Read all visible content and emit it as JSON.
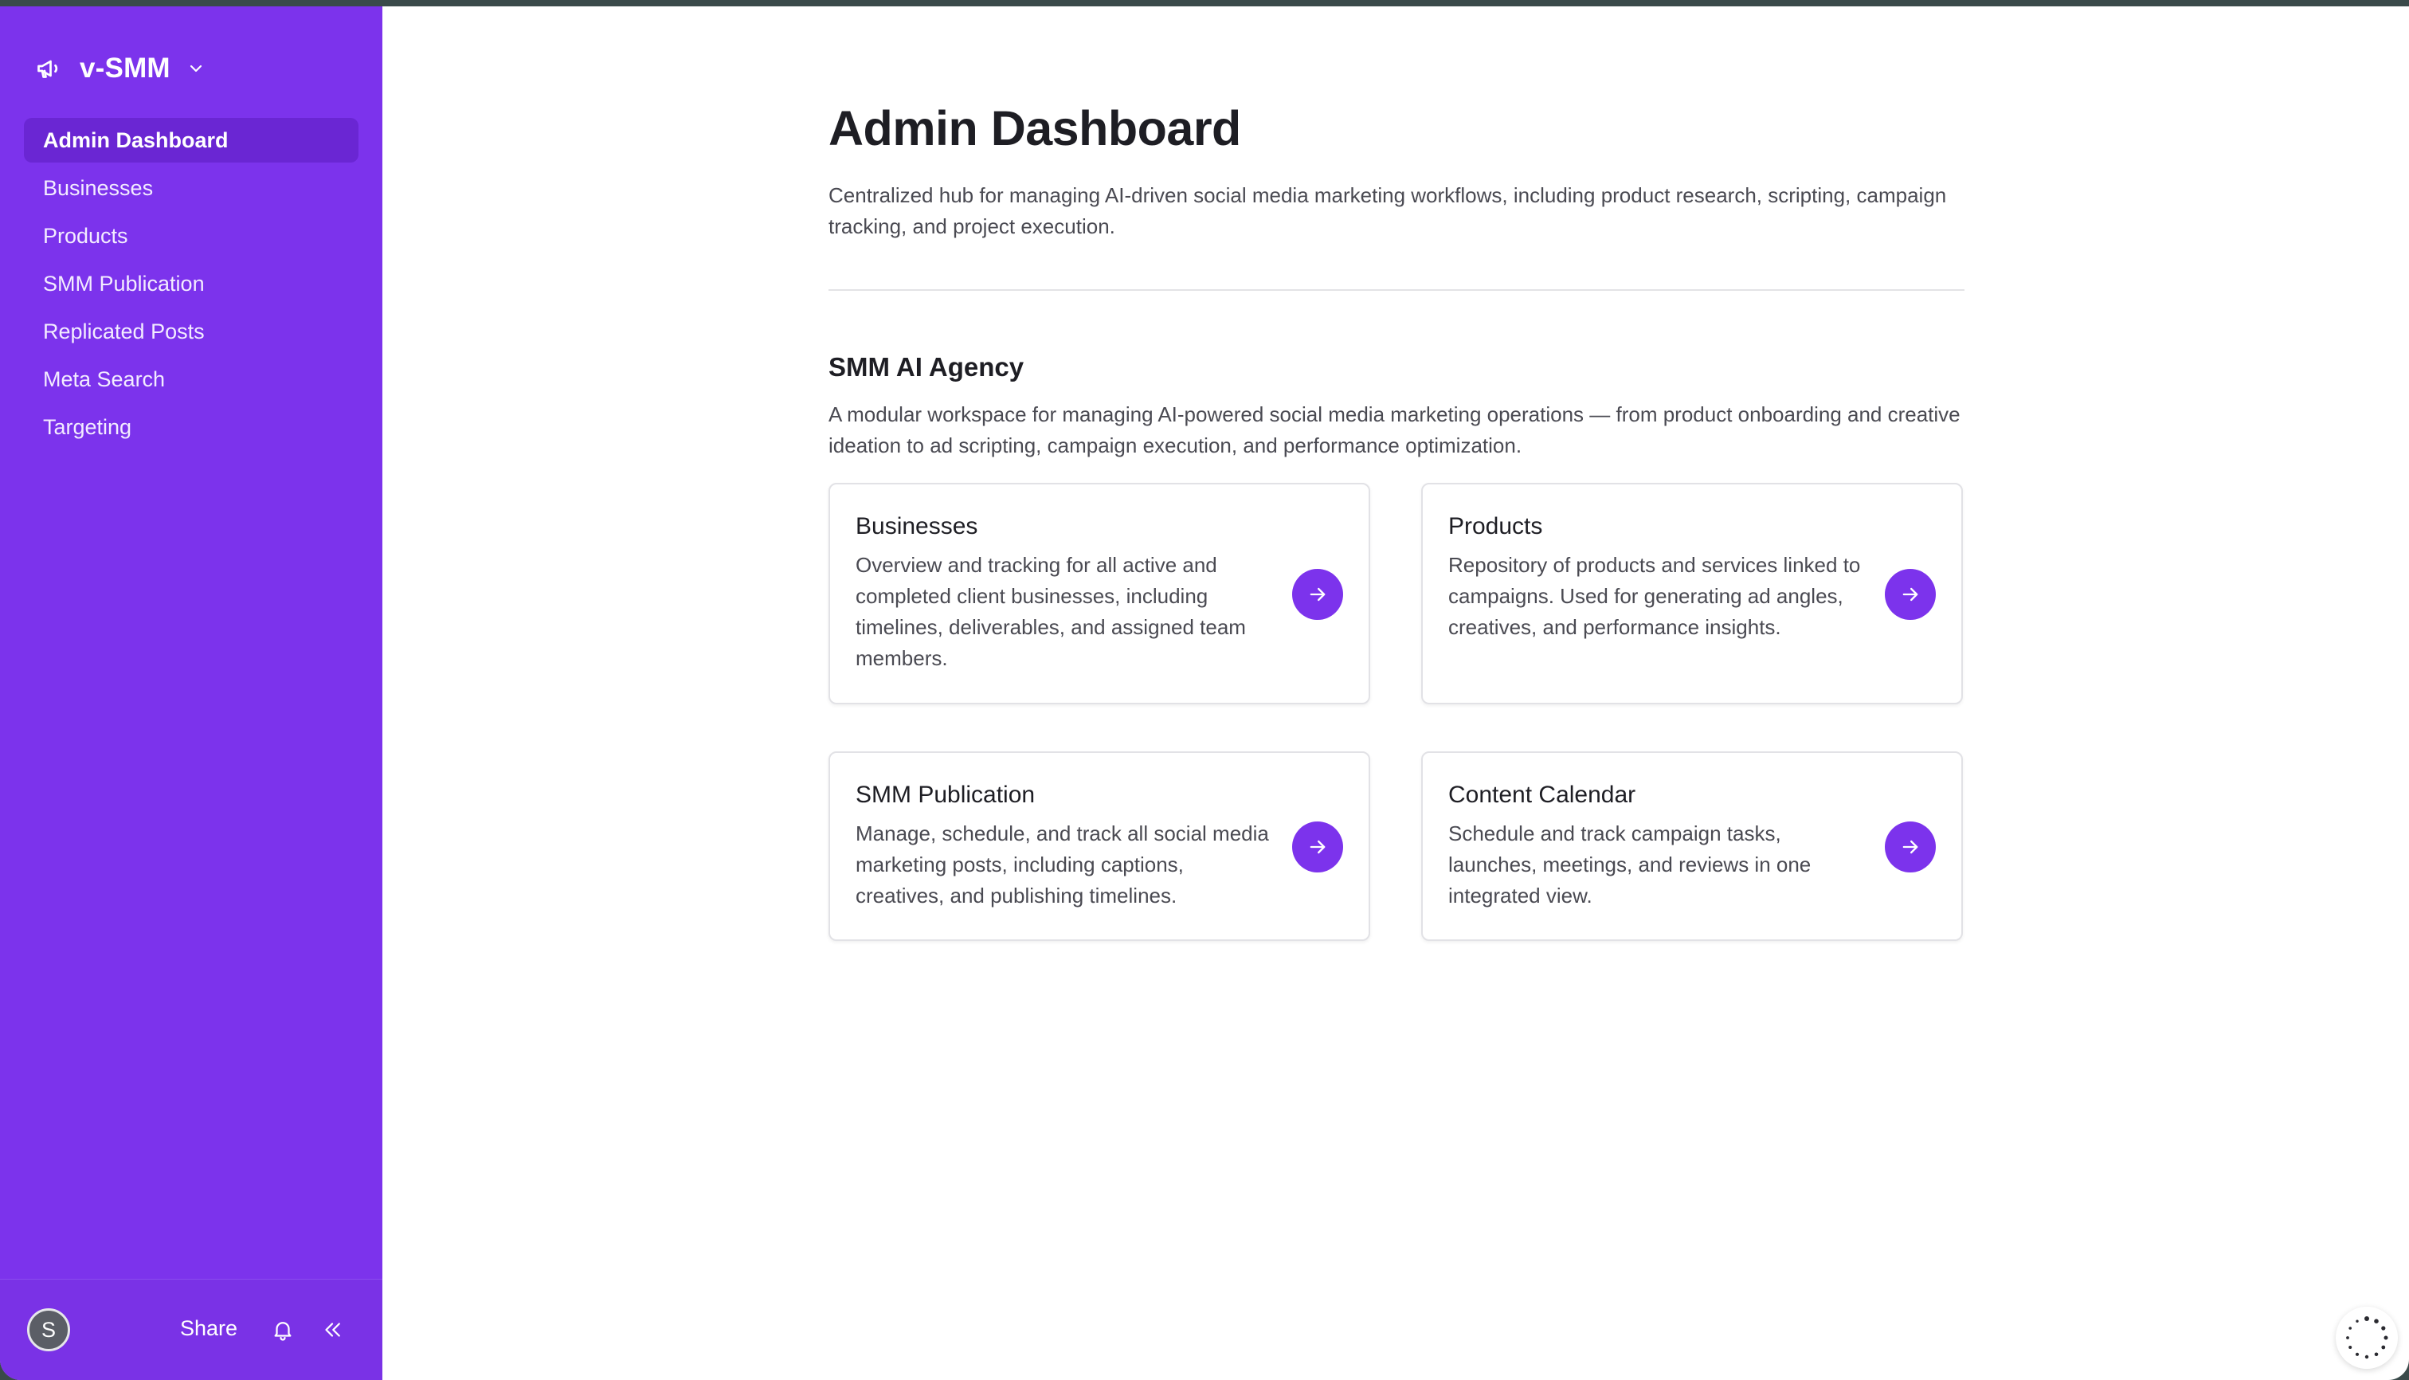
{
  "app": {
    "name": "v-SMM"
  },
  "sidebar": {
    "items": [
      {
        "label": "Admin Dashboard",
        "active": true
      },
      {
        "label": "Businesses",
        "active": false
      },
      {
        "label": "Products",
        "active": false
      },
      {
        "label": "SMM Publication",
        "active": false
      },
      {
        "label": "Replicated Posts",
        "active": false
      },
      {
        "label": "Meta Search",
        "active": false
      },
      {
        "label": "Targeting",
        "active": false
      }
    ],
    "footer": {
      "avatar_initial": "S",
      "share_label": "Share"
    }
  },
  "main": {
    "title": "Admin Dashboard",
    "description": "Centralized hub for managing AI-driven social media marketing workflows, including product research, scripting, campaign tracking, and project execution.",
    "section": {
      "title": "SMM AI Agency",
      "description": "A modular workspace for managing AI-powered social media marketing operations — from product onboarding and creative ideation to ad scripting, campaign execution, and performance optimization."
    },
    "cards": [
      {
        "title": "Businesses",
        "description": "Overview and tracking for all active and completed client businesses, including timelines, deliverables, and assigned team members."
      },
      {
        "title": "Products",
        "description": "Repository of products and services linked to campaigns. Used for generating ad angles, creatives, and performance insights."
      },
      {
        "title": "SMM Publication",
        "description": "Manage, schedule, and track all social media marketing posts, including captions, creatives, and publishing timelines."
      },
      {
        "title": "Content Calendar",
        "description": "Schedule and track campaign tasks, launches, meetings, and reviews in one integrated view."
      }
    ]
  },
  "colors": {
    "sidebar_bg": "#7c33ec",
    "accent": "#7c33ec",
    "active_item_bg": "#6a26d3",
    "text_primary": "#1e1e24",
    "text_secondary": "#4a4a52"
  },
  "icons": {
    "brand": "megaphone-icon",
    "brand_dropdown": "chevron-down-icon",
    "notifications": "bell-icon",
    "collapse": "chevrons-left-icon",
    "card_action": "arrow-right-icon",
    "loader": "spinner-icon"
  }
}
